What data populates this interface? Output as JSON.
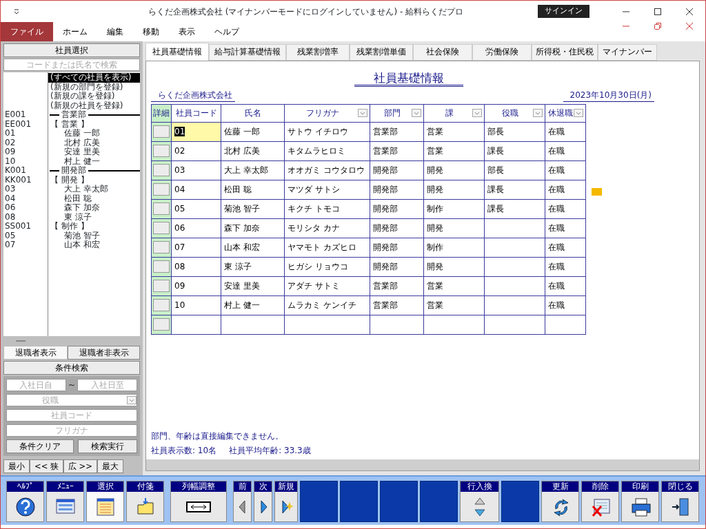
{
  "window": {
    "title": "らくだ企画株式会社 (マイナンバーモードにログインしていません) - 給料らくだプロ",
    "sign_in": "サインイン"
  },
  "menu": [
    {
      "label": "ファイル",
      "selected": true
    },
    {
      "label": "ホーム",
      "selected": false
    },
    {
      "label": "編集",
      "selected": false
    },
    {
      "label": "移動",
      "selected": false
    },
    {
      "label": "表示",
      "selected": false
    },
    {
      "label": "ヘルプ",
      "selected": false
    }
  ],
  "sidebar": {
    "header": "社員選択",
    "search": {
      "placeholder": "コードまたは氏名で検索"
    },
    "items": [
      {
        "kind": "all",
        "label": "(すべての社員を表示)",
        "selected": true
      },
      {
        "kind": "action",
        "label": "(新規の部門を登録)",
        "selected": false
      },
      {
        "kind": "action",
        "label": "(新規の課を登録)",
        "selected": false
      },
      {
        "kind": "action",
        "label": "(新規の社員を登録)",
        "selected": false
      },
      {
        "kind": "department",
        "code": "E001",
        "label": "営業部",
        "selected": false
      },
      {
        "kind": "section",
        "code": "EE001",
        "label": "【 営業 】",
        "selected": false
      },
      {
        "kind": "employee",
        "code": "01",
        "label": "佐藤 一郎",
        "selected": false
      },
      {
        "kind": "employee",
        "code": "02",
        "label": "北村 広美",
        "selected": false
      },
      {
        "kind": "employee",
        "code": "09",
        "label": "安達 里美",
        "selected": false
      },
      {
        "kind": "employee",
        "code": "10",
        "label": "村上 健一",
        "selected": false
      },
      {
        "kind": "department",
        "code": "K001",
        "label": "開発部",
        "selected": false
      },
      {
        "kind": "section",
        "code": "KK001",
        "label": "【 開発 】",
        "selected": false
      },
      {
        "kind": "employee",
        "code": "03",
        "label": "大上 幸太郎",
        "selected": false
      },
      {
        "kind": "employee",
        "code": "04",
        "label": "松田 聡",
        "selected": false
      },
      {
        "kind": "employee",
        "code": "06",
        "label": "森下 加奈",
        "selected": false
      },
      {
        "kind": "employee",
        "code": "08",
        "label": "東 涼子",
        "selected": false
      },
      {
        "kind": "section",
        "code": "SS001",
        "label": "【 制作 】",
        "selected": false
      },
      {
        "kind": "employee",
        "code": "05",
        "label": "菊池 智子",
        "selected": false
      },
      {
        "kind": "employee",
        "code": "07",
        "label": "山本 和宏",
        "selected": false
      }
    ],
    "retired_toggle": [
      {
        "label": "退職者表示",
        "selected": true
      },
      {
        "label": "退職者非表示",
        "selected": false
      }
    ],
    "filter": {
      "header": "条件検索",
      "date_from": {
        "placeholder": "入社日自"
      },
      "range_separator": "~",
      "date_to": {
        "placeholder": "入社日至"
      },
      "position": {
        "placeholder": "役職"
      },
      "code": {
        "placeholder": "社員コード"
      },
      "kana": {
        "placeholder": "フリガナ"
      },
      "buttons": [
        "条件クリア",
        "検索実行"
      ]
    },
    "width_buttons": [
      "最小",
      "<< 狭",
      "広 >>",
      "最大"
    ]
  },
  "tabs": [
    {
      "label": "社員基礎情報",
      "selected": true
    },
    {
      "label": "給与計算基礎情報",
      "selected": false
    },
    {
      "label": "残業割増率",
      "selected": false
    },
    {
      "label": "残業割増単価",
      "selected": false
    },
    {
      "label": "社会保険",
      "selected": false
    },
    {
      "label": "労働保険",
      "selected": false
    },
    {
      "label": "所得税・住民税",
      "selected": false
    },
    {
      "label": "マイナンバー",
      "selected": false
    }
  ],
  "sheet": {
    "title": "社員基礎情報",
    "company": "らくだ企画株式会社",
    "date": "2023年10月30日(月)",
    "columns": [
      {
        "label": "詳細",
        "filter": false
      },
      {
        "label": "社員コード",
        "filter": false
      },
      {
        "label": "氏名",
        "filter": false
      },
      {
        "label": "フリガナ",
        "filter": true
      },
      {
        "label": "部門",
        "filter": true
      },
      {
        "label": "課",
        "filter": true
      },
      {
        "label": "役職",
        "filter": true
      },
      {
        "label": "休退職",
        "filter": true
      }
    ],
    "rows": [
      {
        "code": "01",
        "name": "佐藤 一郎",
        "kana": "サトウ イチロウ",
        "department": "営業部",
        "section": "営業",
        "position": "部長",
        "status": "在職",
        "selected": true
      },
      {
        "code": "02",
        "name": "北村 広美",
        "kana": "キタムラヒロミ",
        "department": "営業部",
        "section": "営業",
        "position": "課長",
        "status": "在職",
        "selected": false
      },
      {
        "code": "03",
        "name": "大上 幸太郎",
        "kana": "オオガミ コウタロウ",
        "department": "開発部",
        "section": "開発",
        "position": "部長",
        "status": "在職",
        "selected": false
      },
      {
        "code": "04",
        "name": "松田 聡",
        "kana": "マツダ サトシ",
        "department": "開発部",
        "section": "開発",
        "position": "課長",
        "status": "在職",
        "selected": false
      },
      {
        "code": "05",
        "name": "菊池 智子",
        "kana": "キクチ トモコ",
        "department": "開発部",
        "section": "制作",
        "position": "課長",
        "status": "在職",
        "selected": false
      },
      {
        "code": "06",
        "name": "森下 加奈",
        "kana": "モリシタ カナ",
        "department": "開発部",
        "section": "開発",
        "status": "在職",
        "selected": false
      },
      {
        "code": "07",
        "name": "山本 和宏",
        "kana": "ヤマモト カズヒロ",
        "department": "開発部",
        "section": "制作",
        "status": "在職",
        "selected": false
      },
      {
        "code": "08",
        "name": "東 涼子",
        "kana": "ヒガシ リョウコ",
        "department": "開発部",
        "section": "開発",
        "status": "在職",
        "selected": false
      },
      {
        "code": "09",
        "name": "安達 里美",
        "kana": "アダチ サトミ",
        "department": "営業部",
        "section": "営業",
        "status": "在職",
        "selected": false
      },
      {
        "code": "10",
        "name": "村上 健一",
        "kana": "ムラカミ ケンイチ",
        "department": "営業部",
        "section": "営業",
        "status": "在職",
        "selected": false
      }
    ],
    "new_row": true,
    "note": "部門、年齢は直接編集できません。",
    "count": "社員表示数: 10名",
    "average": "社員平均年齢: 33.3歳"
  },
  "toolbar": [
    {
      "kind": "help",
      "label": "ﾍﾙﾌﾟ",
      "selected": false
    },
    {
      "kind": "menu",
      "label": "ﾒﾆｭｰ",
      "selected": false
    },
    {
      "kind": "select",
      "label": "選択",
      "selected": true
    },
    {
      "kind": "note",
      "label": "付箋",
      "selected": false
    },
    {
      "kind": "colwidth",
      "label": "列幅調整",
      "selected": false
    },
    {
      "kind": "prev",
      "label": "前",
      "selected": false
    },
    {
      "kind": "next",
      "label": "次",
      "selected": false
    },
    {
      "kind": "new",
      "label": "新規",
      "selected": false
    },
    {
      "kind": "blank",
      "selected": false
    },
    {
      "kind": "blank",
      "selected": false
    },
    {
      "kind": "blank",
      "selected": false
    },
    {
      "kind": "blank",
      "selected": false
    },
    {
      "kind": "swap",
      "label": "行入換",
      "selected": false
    },
    {
      "kind": "blank",
      "selected": false
    },
    {
      "kind": "refresh",
      "label": "更新",
      "selected": false
    },
    {
      "kind": "delete",
      "label": "削除",
      "selected": false
    },
    {
      "kind": "print",
      "label": "印刷",
      "selected": false
    },
    {
      "kind": "close",
      "label": "閉じる",
      "selected": false
    }
  ]
}
